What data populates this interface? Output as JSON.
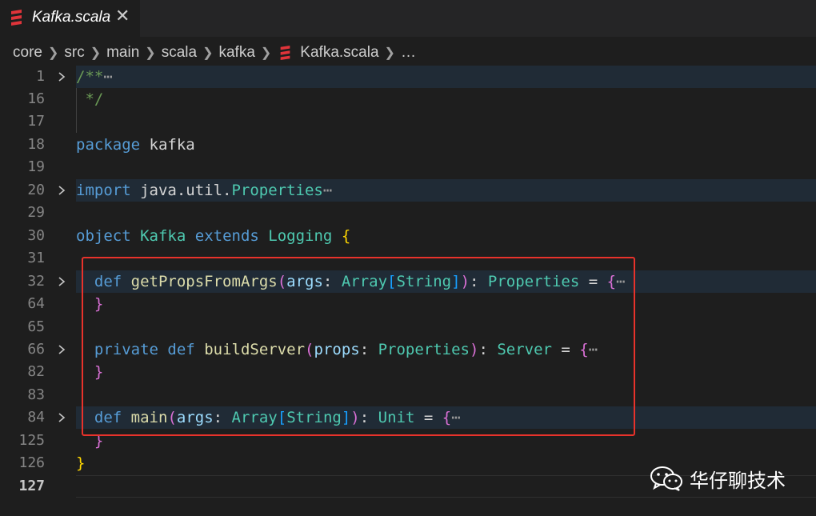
{
  "tab": {
    "title": "Kafka.scala",
    "close": "✕"
  },
  "breadcrumb": [
    "core",
    "src",
    "main",
    "scala",
    "kafka",
    "Kafka.scala",
    "…"
  ],
  "editor": {
    "line_numbers": [
      "1",
      "16",
      "17",
      "18",
      "19",
      "20",
      "29",
      "30",
      "31",
      "32",
      "64",
      "65",
      "66",
      "82",
      "83",
      "84",
      "125",
      "126",
      "127"
    ],
    "current_line": "127"
  },
  "code": {
    "l1": "/**",
    "l16": " */",
    "l18_kw": "package",
    "l18_name": "kafka",
    "l20_kw": "import",
    "l20_path": "java.util.",
    "l20_type": "Properties",
    "l30_kw1": "object",
    "l30_name": "Kafka",
    "l30_kw2": "extends",
    "l30_type": "Logging",
    "l32_def": "def",
    "l32_fn": "getPropsFromArgs",
    "l32_param": "args",
    "l32_type1": "Array",
    "l32_type2": "String",
    "l32_ret": "Properties",
    "l66_priv": "private",
    "l66_def": "def",
    "l66_fn": "buildServer",
    "l66_param": "props",
    "l66_type": "Properties",
    "l66_ret": "Server",
    "l84_def": "def",
    "l84_fn": "main",
    "l84_param": "args",
    "l84_type1": "Array",
    "l84_type2": "String",
    "l84_ret": "Unit",
    "ellipsis": "⋯"
  },
  "watermark": {
    "text": "华仔聊技术"
  },
  "colors": {
    "background": "#1e1e1e",
    "keyword": "#569cd6",
    "type": "#4ec9b0",
    "function": "#dcdcaa",
    "parameter": "#9cdcfe",
    "comment": "#6a9955",
    "bracket_gold": "#ffd700",
    "bracket_pink": "#da70d6",
    "bracket_blue": "#179fff",
    "highlight_box": "#e8322b",
    "scala_icon": "#e0343a"
  }
}
